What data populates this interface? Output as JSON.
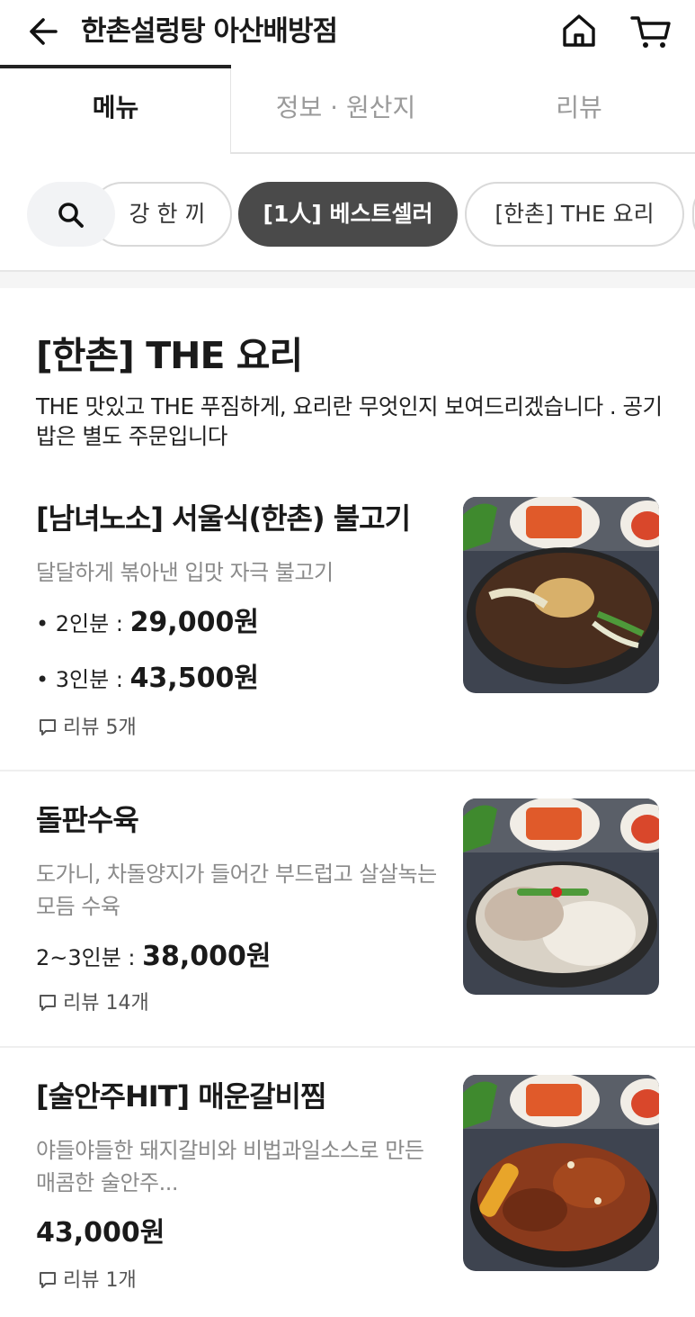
{
  "header": {
    "title": "한촌설렁탕 아산배방점",
    "back_icon": "arrow-left-icon",
    "home_icon": "home-icon",
    "cart_icon": "cart-icon"
  },
  "tabs": [
    {
      "label": "메뉴",
      "active": true
    },
    {
      "label": "정보 · 원산지",
      "active": false
    },
    {
      "label": "리뷰",
      "active": false
    }
  ],
  "filters": {
    "search_icon": "search-icon",
    "chips": [
      {
        "label": "강 한 끼",
        "active": false
      },
      {
        "label": "[1人] 베스트셀러",
        "active": true
      },
      {
        "label": "[한촌] THE 요리",
        "active": false
      }
    ]
  },
  "section": {
    "title": "[한촌] THE 요리",
    "description": "THE 맛있고 THE 푸짐하게, 요리란 무엇인지 보여드리겠습니다 . 공기밥은 별도 주문입니다"
  },
  "items": [
    {
      "name": "[남녀노소] 서울식(한촌)  불고기",
      "description": "달달하게 볶아낸 입맛 자극 불고기",
      "prices": [
        {
          "label": "• 2인분 : ",
          "value": "29,000원"
        },
        {
          "label": "• 3인분 : ",
          "value": "43,500원"
        }
      ],
      "review": "리뷰 5개"
    },
    {
      "name": "돌판수육",
      "description": "도가니, 차돌양지가 들어간 부드럽고 살살녹는 모듬 수육",
      "prices": [
        {
          "label": "2~3인분 : ",
          "value": "38,000원"
        }
      ],
      "review": "리뷰 14개"
    },
    {
      "name": "[술안주HIT] 매운갈비찜",
      "description": "야들야들한 돼지갈비와 비법과일소스로 만든 매콤한 술안주...",
      "prices": [
        {
          "label": "",
          "value": "43,000원"
        }
      ],
      "review": "리뷰 1개"
    }
  ],
  "colors": {
    "active_chip_bg": "#4a4a4a",
    "text_primary": "#1a1a1a",
    "text_secondary": "#8a8a8a"
  }
}
